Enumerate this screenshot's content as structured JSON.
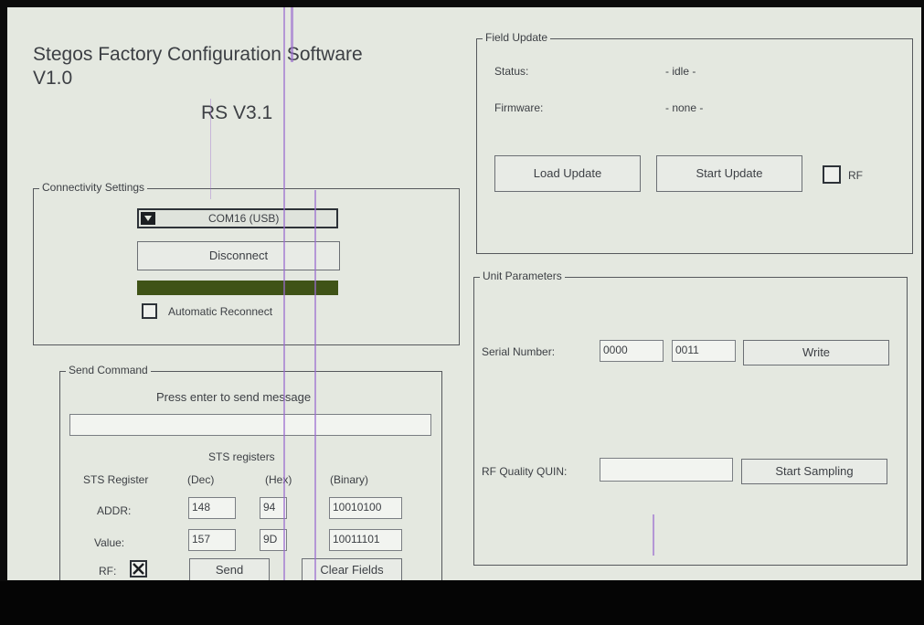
{
  "app": {
    "title_line1": "Stegos Factory Configuration Software",
    "title_line2": "V1.0",
    "rs_version": "RS V3.1"
  },
  "connectivity": {
    "legend": "Connectivity Settings",
    "port_value": "COM16 (USB)",
    "disconnect_label": "Disconnect",
    "auto_reconnect_label": "Automatic Reconnect",
    "auto_reconnect_checked": false,
    "status_bar_color": "#3f5317"
  },
  "send_command": {
    "legend": "Send Command",
    "hint": "Press enter to send message",
    "message_value": "",
    "registers_title": "STS registers",
    "col_register": "STS Register",
    "col_dec": "(Dec)",
    "col_hex": "(Hex)",
    "col_binary": "(Binary)",
    "rows": [
      {
        "label": "ADDR:",
        "dec": "148",
        "hex": "94",
        "binary": "10010100"
      },
      {
        "label": "Value:",
        "dec": "157",
        "hex": "9D",
        "binary": "10011101"
      }
    ],
    "rf_label": "RF:",
    "rf_checked": true,
    "send_label": "Send",
    "clear_label": "Clear Fields"
  },
  "field_update": {
    "legend": "Field Update",
    "status_label": "Status:",
    "status_value": "- idle -",
    "firmware_label": "Firmware:",
    "firmware_value": "- none -",
    "load_label": "Load Update",
    "start_label": "Start Update",
    "rf_label": "RF",
    "rf_checked": false
  },
  "unit_params": {
    "legend": "Unit Parameters",
    "serial_label": "Serial Number:",
    "serial_part1": "0000",
    "serial_part2": "0011",
    "write_label": "Write",
    "rf_quality_label": "RF Quality QUIN:",
    "rf_quality_value": "",
    "sampling_label": "Start Sampling"
  }
}
